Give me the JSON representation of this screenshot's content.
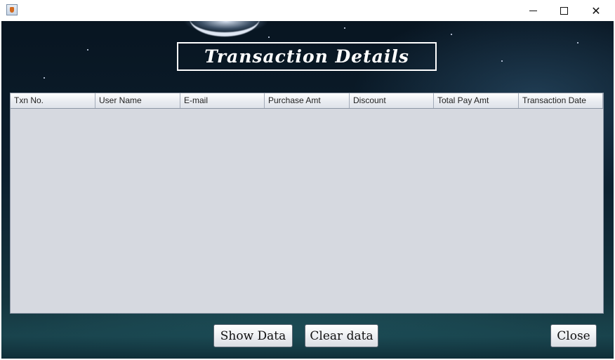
{
  "window": {
    "icon": "java-cup-icon"
  },
  "header": {
    "title": "Transaction Details"
  },
  "table": {
    "columns": [
      "Txn No.",
      "User Name",
      "E-mail",
      "Purchase Amt",
      "Discount",
      "Total Pay Amt",
      "Transaction Date"
    ],
    "rows": []
  },
  "buttons": {
    "show_data": "Show Data",
    "clear_data": "Clear data",
    "close": "Close"
  },
  "colors": {
    "table_background": "#d6d9e0",
    "sky_dark": "#081521"
  }
}
